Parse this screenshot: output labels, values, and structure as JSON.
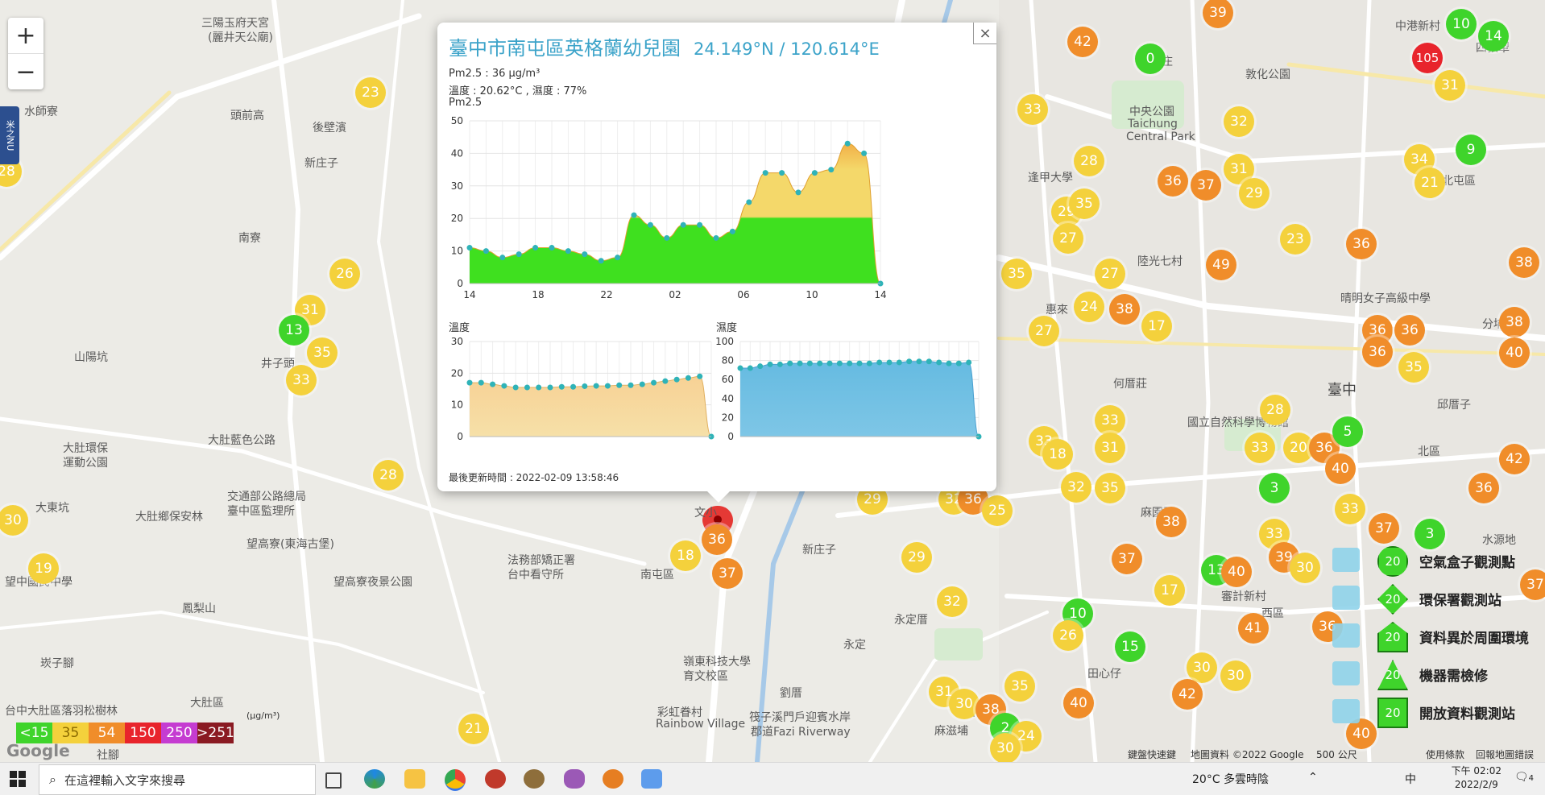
{
  "map": {
    "zoom_in": "+",
    "zoom_out": "−",
    "side_tab": "米之NU",
    "places": [
      {
        "t": "三陽玉府天宮",
        "x": 250,
        "y": 18
      },
      {
        "t": "(麗井天公廟)",
        "x": 258,
        "y": 36
      },
      {
        "t": "水師寮",
        "x": 30,
        "y": 128
      },
      {
        "t": "頭前高",
        "x": 286,
        "y": 133
      },
      {
        "t": "後壁濱",
        "x": 388,
        "y": 148
      },
      {
        "t": "新庄子",
        "x": 378,
        "y": 192
      },
      {
        "t": "南寮",
        "x": 296,
        "y": 285
      },
      {
        "t": "井子頭",
        "x": 324,
        "y": 441
      },
      {
        "t": "山陽坑",
        "x": 92,
        "y": 433
      },
      {
        "t": "大肚環保",
        "x": 78,
        "y": 546
      },
      {
        "t": "運動公園",
        "x": 78,
        "y": 564
      },
      {
        "t": "大肚藍色公路",
        "x": 258,
        "y": 536
      },
      {
        "t": "交通部公路總局",
        "x": 282,
        "y": 606
      },
      {
        "t": "臺中區監理所",
        "x": 282,
        "y": 624
      },
      {
        "t": "大東坑",
        "x": 44,
        "y": 620
      },
      {
        "t": "大肚鄉保安林",
        "x": 168,
        "y": 631
      },
      {
        "t": "望高寮(東海古堡)",
        "x": 306,
        "y": 665
      },
      {
        "t": "望高寮夜景公園",
        "x": 414,
        "y": 712
      },
      {
        "t": "鳳梨山",
        "x": 226,
        "y": 745
      },
      {
        "t": "法務部矯正署",
        "x": 630,
        "y": 685
      },
      {
        "t": "台中看守所",
        "x": 630,
        "y": 703
      },
      {
        "t": "南屯區",
        "x": 795,
        "y": 703
      },
      {
        "t": "新庄子",
        "x": 996,
        "y": 672
      },
      {
        "t": "永定",
        "x": 1047,
        "y": 790
      },
      {
        "t": "永定厝",
        "x": 1110,
        "y": 759
      },
      {
        "t": "嶺東科技大學",
        "x": 848,
        "y": 811
      },
      {
        "t": "育文校區",
        "x": 848,
        "y": 829
      },
      {
        "t": "彩虹眷村",
        "x": 816,
        "y": 874
      },
      {
        "t": "Rainbow Village",
        "x": 814,
        "y": 891
      },
      {
        "t": "劉厝",
        "x": 968,
        "y": 850
      },
      {
        "t": "筏子溪門戶迎賓水岸",
        "x": 930,
        "y": 880
      },
      {
        "t": "郡道Fazi Riverway",
        "x": 932,
        "y": 898
      },
      {
        "t": "大肚區",
        "x": 236,
        "y": 862
      },
      {
        "t": "台中大肚區落羽松樹林",
        "x": 6,
        "y": 872
      },
      {
        "t": "崁子腳",
        "x": 50,
        "y": 813
      },
      {
        "t": "社腳",
        "x": 120,
        "y": 927
      },
      {
        "t": "中港新村",
        "x": 1732,
        "y": 22
      },
      {
        "t": "四張犁",
        "x": 1832,
        "y": 49
      },
      {
        "t": "後庄",
        "x": 1428,
        "y": 66
      },
      {
        "t": "敦化公園",
        "x": 1546,
        "y": 82
      },
      {
        "t": "中央公園",
        "x": 1402,
        "y": 128
      },
      {
        "t": "Taichung",
        "x": 1400,
        "y": 146
      },
      {
        "t": "Central Park",
        "x": 1398,
        "y": 162
      },
      {
        "t": "逢甲大學",
        "x": 1276,
        "y": 210
      },
      {
        "t": "北屯區",
        "x": 1790,
        "y": 214
      },
      {
        "t": "陸光七村",
        "x": 1412,
        "y": 314
      },
      {
        "t": "惠來",
        "x": 1298,
        "y": 374
      },
      {
        "t": "何厝莊",
        "x": 1382,
        "y": 466
      },
      {
        "t": "臺中",
        "x": 1648,
        "y": 470,
        "big": true
      },
      {
        "t": "北區",
        "x": 1760,
        "y": 550
      },
      {
        "t": "麻園頭",
        "x": 1416,
        "y": 626
      },
      {
        "t": "水源地",
        "x": 1840,
        "y": 660
      },
      {
        "t": "審計新村",
        "x": 1516,
        "y": 730
      },
      {
        "t": "西區",
        "x": 1566,
        "y": 751
      },
      {
        "t": "田心仔",
        "x": 1350,
        "y": 826
      },
      {
        "t": "和厝",
        "x": 1184,
        "y": 874
      },
      {
        "t": "麻滋埔",
        "x": 1160,
        "y": 897
      },
      {
        "t": "國立自然科學博物館",
        "x": 1474,
        "y": 514
      },
      {
        "t": "邱厝子",
        "x": 1784,
        "y": 492
      },
      {
        "t": "分埔",
        "x": 1840,
        "y": 392
      },
      {
        "t": "晴明女子高級中學",
        "x": 1664,
        "y": 360
      },
      {
        "t": "文小",
        "x": 862,
        "y": 626
      },
      {
        "t": "望中國民中學",
        "x": 6,
        "y": 712
      }
    ],
    "markers": [
      {
        "v": "23",
        "x": 460,
        "y": 115,
        "c": "#f4d13c"
      },
      {
        "v": "26",
        "x": 428,
        "y": 340,
        "c": "#f4d13c"
      },
      {
        "v": "31",
        "x": 385,
        "y": 385,
        "c": "#f4d13c"
      },
      {
        "v": "13",
        "x": 365,
        "y": 410,
        "c": "#3fd42b"
      },
      {
        "v": "35",
        "x": 400,
        "y": 438,
        "c": "#f4d13c"
      },
      {
        "v": "33",
        "x": 374,
        "y": 472,
        "c": "#f4d13c"
      },
      {
        "v": "28",
        "x": 482,
        "y": 590,
        "c": "#f4d13c"
      },
      {
        "v": "30",
        "x": 16,
        "y": 646,
        "c": "#f4d13c"
      },
      {
        "v": "21",
        "x": 588,
        "y": 905,
        "c": "#f4d13c"
      },
      {
        "v": "18",
        "x": 851,
        "y": 690,
        "c": "#f4d13c"
      },
      {
        "v": "36",
        "x": 890,
        "y": 670,
        "c": "#f08d2a"
      },
      {
        "v": "37",
        "x": 903,
        "y": 712,
        "c": "#f08d2a"
      },
      {
        "v": "29",
        "x": 1138,
        "y": 692,
        "c": "#f4d13c"
      },
      {
        "v": "32",
        "x": 1182,
        "y": 747,
        "c": "#f4d13c"
      },
      {
        "v": "29",
        "x": 1083,
        "y": 620,
        "c": "#f4d13c"
      },
      {
        "v": "32",
        "x": 1184,
        "y": 620,
        "c": "#f4d13c"
      },
      {
        "v": "36",
        "x": 1208,
        "y": 620,
        "c": "#f08d2a"
      },
      {
        "v": "25",
        "x": 1238,
        "y": 634,
        "c": "#f4d13c"
      },
      {
        "v": "39",
        "x": 1512,
        "y": 16,
        "c": "#f08d2a"
      },
      {
        "v": "42",
        "x": 1344,
        "y": 52,
        "c": "#f08d2a"
      },
      {
        "v": "0",
        "x": 1428,
        "y": 73,
        "c": "#3fd42b"
      },
      {
        "v": "33",
        "x": 1282,
        "y": 136,
        "c": "#f4d13c"
      },
      {
        "v": "32",
        "x": 1538,
        "y": 151,
        "c": "#f4d13c"
      },
      {
        "v": "28",
        "x": 1352,
        "y": 200,
        "c": "#f4d13c"
      },
      {
        "v": "31",
        "x": 1538,
        "y": 210,
        "c": "#f4d13c"
      },
      {
        "v": "36",
        "x": 1456,
        "y": 225,
        "c": "#f08d2a"
      },
      {
        "v": "37",
        "x": 1497,
        "y": 230,
        "c": "#f08d2a"
      },
      {
        "v": "29",
        "x": 1557,
        "y": 240,
        "c": "#f4d13c"
      },
      {
        "v": "29",
        "x": 1324,
        "y": 263,
        "c": "#f4d13c"
      },
      {
        "v": "35",
        "x": 1346,
        "y": 253,
        "c": "#f4d13c"
      },
      {
        "v": "27",
        "x": 1326,
        "y": 296,
        "c": "#f4d13c"
      },
      {
        "v": "23",
        "x": 1608,
        "y": 297,
        "c": "#f4d13c"
      },
      {
        "v": "36",
        "x": 1690,
        "y": 303,
        "c": "#f08d2a"
      },
      {
        "v": "35",
        "x": 1262,
        "y": 340,
        "c": "#f4d13c"
      },
      {
        "v": "27",
        "x": 1378,
        "y": 340,
        "c": "#f4d13c"
      },
      {
        "v": "49",
        "x": 1516,
        "y": 329,
        "c": "#f08d2a"
      },
      {
        "v": "24",
        "x": 1352,
        "y": 381,
        "c": "#f4d13c"
      },
      {
        "v": "38",
        "x": 1396,
        "y": 384,
        "c": "#f08d2a"
      },
      {
        "v": "17",
        "x": 1436,
        "y": 405,
        "c": "#f4d13c"
      },
      {
        "v": "27",
        "x": 1296,
        "y": 411,
        "c": "#f4d13c"
      },
      {
        "v": "36",
        "x": 1710,
        "y": 410,
        "c": "#f08d2a"
      },
      {
        "v": "36",
        "x": 1750,
        "y": 410,
        "c": "#f08d2a"
      },
      {
        "v": "36",
        "x": 1710,
        "y": 437,
        "c": "#f08d2a"
      },
      {
        "v": "35",
        "x": 1755,
        "y": 456,
        "c": "#f4d13c"
      },
      {
        "v": "28",
        "x": 1583,
        "y": 509,
        "c": "#f4d13c"
      },
      {
        "v": "33",
        "x": 1378,
        "y": 522,
        "c": "#f4d13c"
      },
      {
        "v": "31",
        "x": 1378,
        "y": 556,
        "c": "#f4d13c"
      },
      {
        "v": "33",
        "x": 1296,
        "y": 548,
        "c": "#f4d13c"
      },
      {
        "v": "18",
        "x": 1313,
        "y": 564,
        "c": "#f4d13c"
      },
      {
        "v": "32",
        "x": 1336,
        "y": 605,
        "c": "#f4d13c"
      },
      {
        "v": "35",
        "x": 1378,
        "y": 606,
        "c": "#f4d13c"
      },
      {
        "v": "33",
        "x": 1564,
        "y": 556,
        "c": "#f4d13c"
      },
      {
        "v": "20",
        "x": 1612,
        "y": 556,
        "c": "#f4d13c"
      },
      {
        "v": "36",
        "x": 1644,
        "y": 556,
        "c": "#f08d2a"
      },
      {
        "v": "5",
        "x": 1673,
        "y": 536,
        "c": "#3fd42b"
      },
      {
        "v": "40",
        "x": 1664,
        "y": 582,
        "c": "#f08d2a"
      },
      {
        "v": "3",
        "x": 1582,
        "y": 606,
        "c": "#3fd42b"
      },
      {
        "v": "33",
        "x": 1676,
        "y": 632,
        "c": "#f4d13c"
      },
      {
        "v": "38",
        "x": 1454,
        "y": 648,
        "c": "#f08d2a"
      },
      {
        "v": "33",
        "x": 1582,
        "y": 663,
        "c": "#f4d13c"
      },
      {
        "v": "37",
        "x": 1718,
        "y": 656,
        "c": "#f08d2a"
      },
      {
        "v": "3",
        "x": 1775,
        "y": 663,
        "c": "#3fd42b"
      },
      {
        "v": "37",
        "x": 1399,
        "y": 694,
        "c": "#f08d2a"
      },
      {
        "v": "39",
        "x": 1594,
        "y": 692,
        "c": "#f08d2a"
      },
      {
        "v": "30",
        "x": 1620,
        "y": 705,
        "c": "#f4d13c"
      },
      {
        "v": "13",
        "x": 1510,
        "y": 708,
        "c": "#3fd42b"
      },
      {
        "v": "40",
        "x": 1535,
        "y": 710,
        "c": "#f08d2a"
      },
      {
        "v": "17",
        "x": 1452,
        "y": 733,
        "c": "#f4d13c"
      },
      {
        "v": "10",
        "x": 1338,
        "y": 762,
        "c": "#3fd42b"
      },
      {
        "v": "41",
        "x": 1556,
        "y": 780,
        "c": "#f08d2a"
      },
      {
        "v": "36",
        "x": 1648,
        "y": 778,
        "c": "#f08d2a"
      },
      {
        "v": "26",
        "x": 1326,
        "y": 789,
        "c": "#f4d13c"
      },
      {
        "v": "15",
        "x": 1403,
        "y": 803,
        "c": "#3fd42b"
      },
      {
        "v": "30",
        "x": 1492,
        "y": 829,
        "c": "#f4d13c"
      },
      {
        "v": "30",
        "x": 1534,
        "y": 839,
        "c": "#f4d13c"
      },
      {
        "v": "42",
        "x": 1474,
        "y": 862,
        "c": "#f08d2a"
      },
      {
        "v": "35",
        "x": 1266,
        "y": 852,
        "c": "#f4d13c"
      },
      {
        "v": "31",
        "x": 1172,
        "y": 859,
        "c": "#f4d13c"
      },
      {
        "v": "30",
        "x": 1197,
        "y": 874,
        "c": "#f4d13c"
      },
      {
        "v": "38",
        "x": 1230,
        "y": 881,
        "c": "#f08d2a"
      },
      {
        "v": "40",
        "x": 1339,
        "y": 873,
        "c": "#f08d2a"
      },
      {
        "v": "2",
        "x": 1248,
        "y": 904,
        "c": "#3fd42b"
      },
      {
        "v": "24",
        "x": 1274,
        "y": 914,
        "c": "#f4d13c"
      },
      {
        "v": "30",
        "x": 1248,
        "y": 929,
        "c": "#f4d13c"
      },
      {
        "v": "40",
        "x": 1690,
        "y": 911,
        "c": "#f08d2a"
      },
      {
        "v": "10",
        "x": 1814,
        "y": 30,
        "c": "#3fd42b"
      },
      {
        "v": "14",
        "x": 1854,
        "y": 45,
        "c": "#3fd42b"
      },
      {
        "v": "105",
        "x": 1772,
        "y": 72,
        "c": "#e8242c"
      },
      {
        "v": "31",
        "x": 1800,
        "y": 106,
        "c": "#f4d13c"
      },
      {
        "v": "9",
        "x": 1826,
        "y": 186,
        "c": "#3fd42b"
      },
      {
        "v": "34",
        "x": 1762,
        "y": 198,
        "c": "#f4d13c"
      },
      {
        "v": "21",
        "x": 1775,
        "y": 227,
        "c": "#f4d13c"
      },
      {
        "v": "38",
        "x": 1892,
        "y": 326,
        "c": "#f08d2a"
      },
      {
        "v": "38",
        "x": 1880,
        "y": 400,
        "c": "#f08d2a"
      },
      {
        "v": "40",
        "x": 1880,
        "y": 438,
        "c": "#f08d2a"
      },
      {
        "v": "42",
        "x": 1880,
        "y": 570,
        "c": "#f08d2a"
      },
      {
        "v": "36",
        "x": 1842,
        "y": 606,
        "c": "#f08d2a"
      },
      {
        "v": "37",
        "x": 1906,
        "y": 726,
        "c": "#f08d2a"
      },
      {
        "v": "19",
        "x": 54,
        "y": 706,
        "c": "#f4d13c"
      },
      {
        "v": "28",
        "x": 8,
        "y": 213,
        "c": "#f4d13c"
      }
    ],
    "selected_pin_value": "36",
    "attribution": [
      "鍵盤快速鍵",
      "地圖資料 ©2022 Google",
      "500 公尺",
      "使用條款",
      "回報地圖錯誤"
    ],
    "google_logo": "Google"
  },
  "popup": {
    "close": "×",
    "title": "臺中市南屯區英格蘭幼兒園",
    "coords": "24.149°N / 120.614°E",
    "pm25_line": "Pm2.5 : 36 μg/m³",
    "temp_line": "溫度 : 20.62°C , 濕度 : 77%",
    "pm_chart_label": "Pm2.5",
    "temp_chart_label": "溫度",
    "hum_chart_label": "濕度",
    "updated": "最後更新時間 : 2022-02-09 13:58:46"
  },
  "chart_data": [
    {
      "type": "area",
      "title": "Pm2.5",
      "x_ticks": [
        "14",
        "18",
        "22",
        "02",
        "06",
        "10",
        "14"
      ],
      "ylim": [
        0,
        50
      ],
      "y_ticks": [
        0,
        10,
        20,
        30,
        40,
        50
      ],
      "values": [
        11,
        10,
        8,
        9,
        11,
        11,
        10,
        9,
        7,
        8,
        21,
        18,
        14,
        18,
        18,
        14,
        16,
        25,
        34,
        34,
        28,
        34,
        35,
        43,
        40,
        0
      ],
      "threshold": 20,
      "grid": true
    },
    {
      "type": "area",
      "title": "溫度",
      "ylim": [
        0,
        30
      ],
      "y_ticks": [
        0,
        10,
        20,
        30
      ],
      "values": [
        17,
        17,
        16.5,
        16,
        15.5,
        15.5,
        15.5,
        15.5,
        15.7,
        15.7,
        15.9,
        16,
        16,
        16.2,
        16.2,
        16.5,
        17,
        17.5,
        18,
        18.5,
        19,
        0
      ],
      "grid": true
    },
    {
      "type": "area",
      "title": "濕度",
      "ylim": [
        0,
        100
      ],
      "y_ticks": [
        0,
        20,
        40,
        60,
        80,
        100
      ],
      "values": [
        72,
        72,
        74,
        76,
        76,
        77,
        77,
        77,
        77,
        77,
        77,
        77,
        77,
        77,
        78,
        78,
        78,
        79,
        79,
        79,
        78,
        77,
        77,
        78,
        0
      ],
      "grid": true
    }
  ],
  "legend": {
    "unit": "(μg/m³)",
    "scale": [
      {
        "label": "<15",
        "color": "#3fd42b"
      },
      {
        "label": "35",
        "color": "#f4d13c"
      },
      {
        "label": "54",
        "color": "#f08d2a"
      },
      {
        "label": "150",
        "color": "#e8242c"
      },
      {
        "label": "250",
        "color": "#c53cd1"
      },
      {
        "label": ">251",
        "color": "#8a1a22"
      }
    ],
    "types": [
      {
        "label": "空氣盒子觀測點",
        "value": "20",
        "shape": "circle"
      },
      {
        "label": "環保署觀測站",
        "value": "20",
        "shape": "diamond"
      },
      {
        "label": "資料異於周圍環境",
        "value": "20",
        "shape": "pentagon"
      },
      {
        "label": "機器需檢修",
        "value": "20",
        "shape": "triangle"
      },
      {
        "label": "開放資料觀測站",
        "value": "20",
        "shape": "square"
      }
    ]
  },
  "taskbar": {
    "search_placeholder": "在這裡輸入文字來搜尋",
    "weather": "20°C 多雲時陰",
    "ime": "中",
    "time": "下午 02:02",
    "date": "2022/2/9",
    "notifications": "4"
  }
}
